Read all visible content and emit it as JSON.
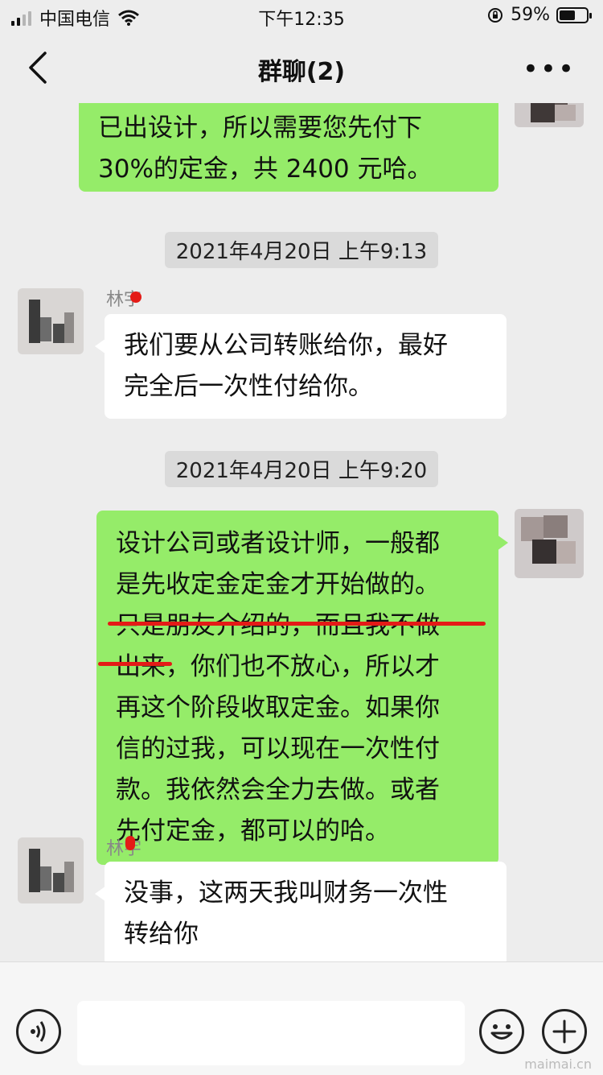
{
  "status_bar": {
    "carrier": "中国电信",
    "time": "下午12:35",
    "battery": "59%",
    "battery_level": 0.59
  },
  "nav": {
    "title": "群聊(2)",
    "more": "•••"
  },
  "messages": [
    {
      "type": "sent",
      "lines": [
        "已出设计，所以需要您先付下",
        "30%的定金，共 2400 元哈。"
      ]
    },
    {
      "type": "time",
      "text": "2021年4月20日 上午9:13"
    },
    {
      "type": "received",
      "sender": "林宇",
      "lines": [
        "我们要从公司转账给你，最好",
        "完全后一次性付给你。"
      ]
    },
    {
      "type": "time",
      "text": "2021年4月20日 上午9:20"
    },
    {
      "type": "sent",
      "lines": [
        "设计公司或者设计师，一般都",
        "是先收定金定金才开始做的。",
        "只是朋友介绍的，而且我不做",
        "出来，你们也不放心，所以才",
        "再这个阶段收取定金。如果你",
        "信的过我，可以现在一次性付",
        "款。我依然会全力去做。或者",
        "先付定金，都可以的哈。"
      ]
    },
    {
      "type": "received",
      "sender": "林宇",
      "lines": [
        "没事，这两天我叫财务一次性",
        "转给你"
      ]
    }
  ],
  "input": {
    "placeholder": ""
  },
  "watermark": "maimai.cn",
  "icons": [
    "back-chevron-icon",
    "more-icon",
    "voice-icon",
    "emoji-icon",
    "plus-icon",
    "wifi-icon",
    "battery-icon"
  ]
}
